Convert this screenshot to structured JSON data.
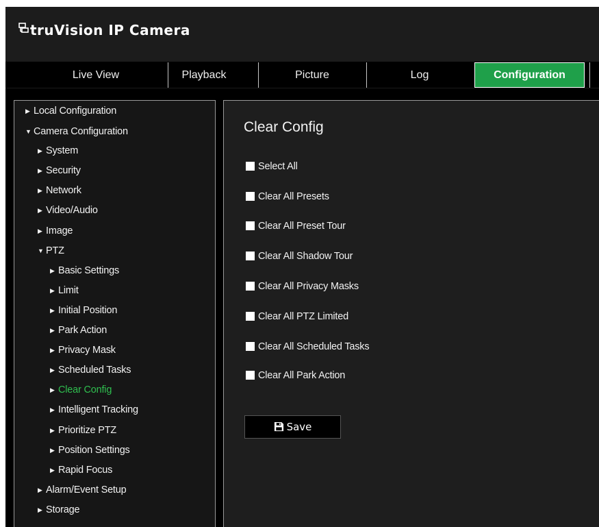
{
  "app": {
    "brand": "truVision IP Camera"
  },
  "nav": {
    "tabs": [
      {
        "label": "Live View"
      },
      {
        "label": "Playback"
      },
      {
        "label": "Picture"
      },
      {
        "label": "Log"
      },
      {
        "label": "Configuration"
      }
    ],
    "active": "Configuration"
  },
  "sidebar": {
    "items": [
      {
        "label": "Local Configuration",
        "level": 0,
        "expanded": false
      },
      {
        "label": "Camera Configuration",
        "level": 0,
        "expanded": true
      },
      {
        "label": "System",
        "level": 1,
        "expanded": false
      },
      {
        "label": "Security",
        "level": 1,
        "expanded": false
      },
      {
        "label": "Network",
        "level": 1,
        "expanded": false
      },
      {
        "label": "Video/Audio",
        "level": 1,
        "expanded": false
      },
      {
        "label": "Image",
        "level": 1,
        "expanded": false
      },
      {
        "label": "PTZ",
        "level": 1,
        "expanded": true
      },
      {
        "label": "Basic Settings",
        "level": 2,
        "expanded": false
      },
      {
        "label": "Limit",
        "level": 2,
        "expanded": false
      },
      {
        "label": "Initial Position",
        "level": 2,
        "expanded": false
      },
      {
        "label": "Park Action",
        "level": 2,
        "expanded": false
      },
      {
        "label": "Privacy Mask",
        "level": 2,
        "expanded": false
      },
      {
        "label": "Scheduled Tasks",
        "level": 2,
        "expanded": false
      },
      {
        "label": "Clear Config",
        "level": 2,
        "expanded": false,
        "selected": true
      },
      {
        "label": "Intelligent Tracking",
        "level": 2,
        "expanded": false
      },
      {
        "label": "Prioritize PTZ",
        "level": 2,
        "expanded": false
      },
      {
        "label": "Position Settings",
        "level": 2,
        "expanded": false
      },
      {
        "label": "Rapid Focus",
        "level": 2,
        "expanded": false
      },
      {
        "label": "Alarm/Event Setup",
        "level": 1,
        "expanded": false
      },
      {
        "label": "Storage",
        "level": 1,
        "expanded": false
      }
    ]
  },
  "main": {
    "title": "Clear Config",
    "options": [
      {
        "label": "Select All",
        "checked": false
      },
      {
        "label": "Clear All Presets",
        "checked": false
      },
      {
        "label": "Clear All Preset Tour",
        "checked": false
      },
      {
        "label": "Clear All Shadow Tour",
        "checked": false
      },
      {
        "label": "Clear All Privacy Masks",
        "checked": false
      },
      {
        "label": "Clear All PTZ Limited",
        "checked": false
      },
      {
        "label": "Clear All Scheduled Tasks",
        "checked": false
      },
      {
        "label": "Clear All Park Action",
        "checked": false
      }
    ],
    "save_label": "Save"
  },
  "colors": {
    "accent": "#1fa04a",
    "selected_text": "#2fbf4f",
    "background": "#000000",
    "panel": "#1e1e1e"
  },
  "icons": {
    "logo": "camera-network-icon",
    "save": "floppy-disk-icon"
  }
}
